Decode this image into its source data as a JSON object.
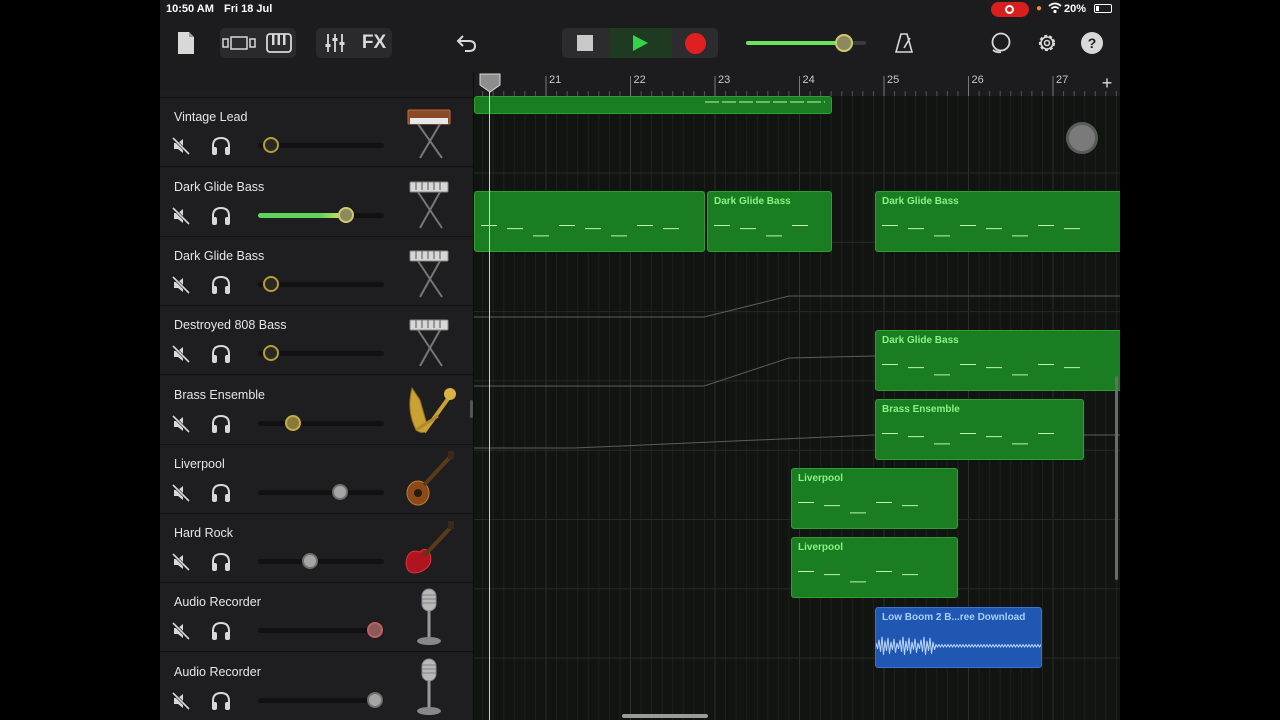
{
  "status_bar": {
    "time": "10:50 AM",
    "date": "Fri 18 Jul",
    "battery": "20%"
  },
  "toolbar": {
    "icons": [
      "my-songs-icon",
      "tracks-view-icon",
      "keyboard-icon",
      "mixer-icon",
      "undo-icon",
      "metronome-icon",
      "loop-browser-icon",
      "settings-icon",
      "help-icon"
    ],
    "fx_label": "FX",
    "help_label": "?",
    "master_volume": 0.82,
    "colors": {
      "play": "#33d44a",
      "record": "#e02020",
      "volume_fill": "#69e45c"
    }
  },
  "ruler": {
    "bars": [
      "21",
      "22",
      "23",
      "24",
      "25",
      "26",
      "27"
    ],
    "add_label": "+"
  },
  "tracks": [
    {
      "name": "",
      "instrument_icon": "keyboard-icon",
      "volume": 0.62,
      "style": "green"
    },
    {
      "name": "Vintage Lead",
      "instrument_icon": "synth-icon",
      "volume": 0.1,
      "style": "yellow-ring"
    },
    {
      "name": "Dark Glide Bass",
      "instrument_icon": "keyboard-icon",
      "volume": 0.7,
      "style": "green-yellow"
    },
    {
      "name": "Dark Glide Bass",
      "instrument_icon": "keyboard-icon",
      "volume": 0.1,
      "style": "yellow-ring"
    },
    {
      "name": "Destroyed 808 Bass",
      "instrument_icon": "keyboard-icon",
      "volume": 0.1,
      "style": "yellow-ring"
    },
    {
      "name": "Brass Ensemble",
      "instrument_icon": "brass-icon",
      "volume": 0.28,
      "style": "yellow-fill"
    },
    {
      "name": "Liverpool",
      "instrument_icon": "bass-guitar-icon",
      "volume": 0.65,
      "style": "grey"
    },
    {
      "name": "Hard Rock",
      "instrument_icon": "electric-guitar-icon",
      "volume": 0.41,
      "style": "grey"
    },
    {
      "name": "Audio Recorder",
      "instrument_icon": "microphone-icon",
      "volume": 0.93,
      "style": "red"
    },
    {
      "name": "Audio Recorder",
      "instrument_icon": "microphone-icon",
      "volume": 0.93,
      "style": "grey"
    }
  ],
  "regions": [
    {
      "track": 0,
      "label": "",
      "type": "midi"
    },
    {
      "track": 2,
      "label": "",
      "type": "midi"
    },
    {
      "track": 2,
      "label": "Dark Glide Bass",
      "type": "midi"
    },
    {
      "track": 2,
      "label": "Dark Glide Bass",
      "type": "midi"
    },
    {
      "track": 4,
      "label": "Dark Glide Bass",
      "type": "midi"
    },
    {
      "track": 5,
      "label": "Brass Ensemble",
      "type": "midi"
    },
    {
      "track": 6,
      "label": "Liverpool",
      "type": "midi"
    },
    {
      "track": 7,
      "label": "Liverpool",
      "type": "midi"
    },
    {
      "track": 8,
      "label": "Low Boom 2  B...ree Download",
      "type": "audio"
    }
  ]
}
